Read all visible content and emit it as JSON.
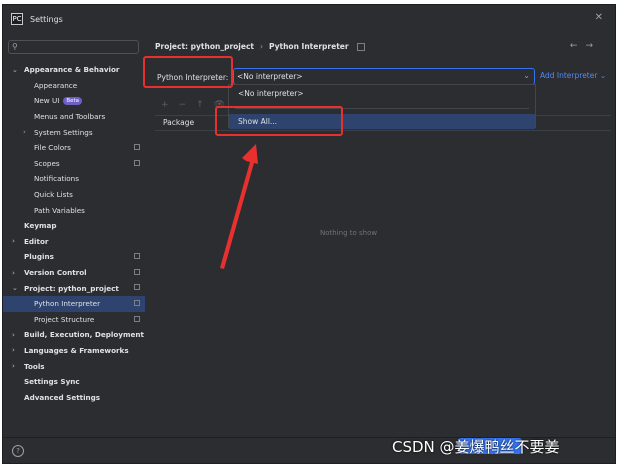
{
  "window": {
    "title": "Settings"
  },
  "search": {
    "placeholder": ""
  },
  "sidebar": {
    "items": [
      {
        "label": "Appearance & Behavior",
        "bold": true,
        "arrow": "expanded",
        "indent": 0
      },
      {
        "label": "Appearance",
        "indent": 2
      },
      {
        "label": "New UI",
        "indent": 2,
        "badge": "Beta"
      },
      {
        "label": "Menus and Toolbars",
        "indent": 2
      },
      {
        "label": "System Settings",
        "indent": 1,
        "arrow": "collapsed"
      },
      {
        "label": "File Colors",
        "indent": 2,
        "pin": true
      },
      {
        "label": "Scopes",
        "indent": 2,
        "pin": true
      },
      {
        "label": "Notifications",
        "indent": 2
      },
      {
        "label": "Quick Lists",
        "indent": 2
      },
      {
        "label": "Path Variables",
        "indent": 2
      },
      {
        "label": "Keymap",
        "bold": true,
        "indent": 0
      },
      {
        "label": "Editor",
        "bold": true,
        "indent": 0,
        "arrow": "collapsed"
      },
      {
        "label": "Plugins",
        "bold": true,
        "indent": 0,
        "pin": true
      },
      {
        "label": "Version Control",
        "bold": true,
        "indent": 0,
        "arrow": "collapsed",
        "pin": true
      },
      {
        "label": "Project: python_project",
        "bold": true,
        "indent": 0,
        "arrow": "expanded",
        "pin": true
      },
      {
        "label": "Python Interpreter",
        "indent": 2,
        "selected": true,
        "pin": true
      },
      {
        "label": "Project Structure",
        "indent": 2,
        "pin": true
      },
      {
        "label": "Build, Execution, Deployment",
        "bold": true,
        "indent": 0,
        "arrow": "collapsed"
      },
      {
        "label": "Languages & Frameworks",
        "bold": true,
        "indent": 0,
        "arrow": "collapsed"
      },
      {
        "label": "Tools",
        "bold": true,
        "indent": 0,
        "arrow": "collapsed"
      },
      {
        "label": "Settings Sync",
        "bold": true,
        "indent": 0
      },
      {
        "label": "Advanced Settings",
        "bold": true,
        "indent": 0
      }
    ]
  },
  "breadcrumb": {
    "project": "Project: python_project",
    "page": "Python Interpreter",
    "separator": "›"
  },
  "nav": {
    "back": "←",
    "forward": "→"
  },
  "interpreter": {
    "label": "Python Interpreter:",
    "value": "<No interpreter>",
    "add_label": "Add Interpreter ⌄"
  },
  "dropdown": {
    "options": [
      "<No interpreter>",
      "Show All..."
    ],
    "highlighted": "Show All..."
  },
  "packages": {
    "toolbar": [
      "+",
      "−",
      "↑",
      "👁"
    ],
    "column_header": "Package",
    "empty_text": "Nothing to show"
  },
  "footer": {
    "help": "?"
  },
  "watermark": {
    "text": "CSDN @姜爆鸭丝不要姜"
  },
  "colors": {
    "accent": "#3574f0",
    "highlight": "#e8312f",
    "selection": "#2e436e",
    "background": "#2b2d30"
  }
}
